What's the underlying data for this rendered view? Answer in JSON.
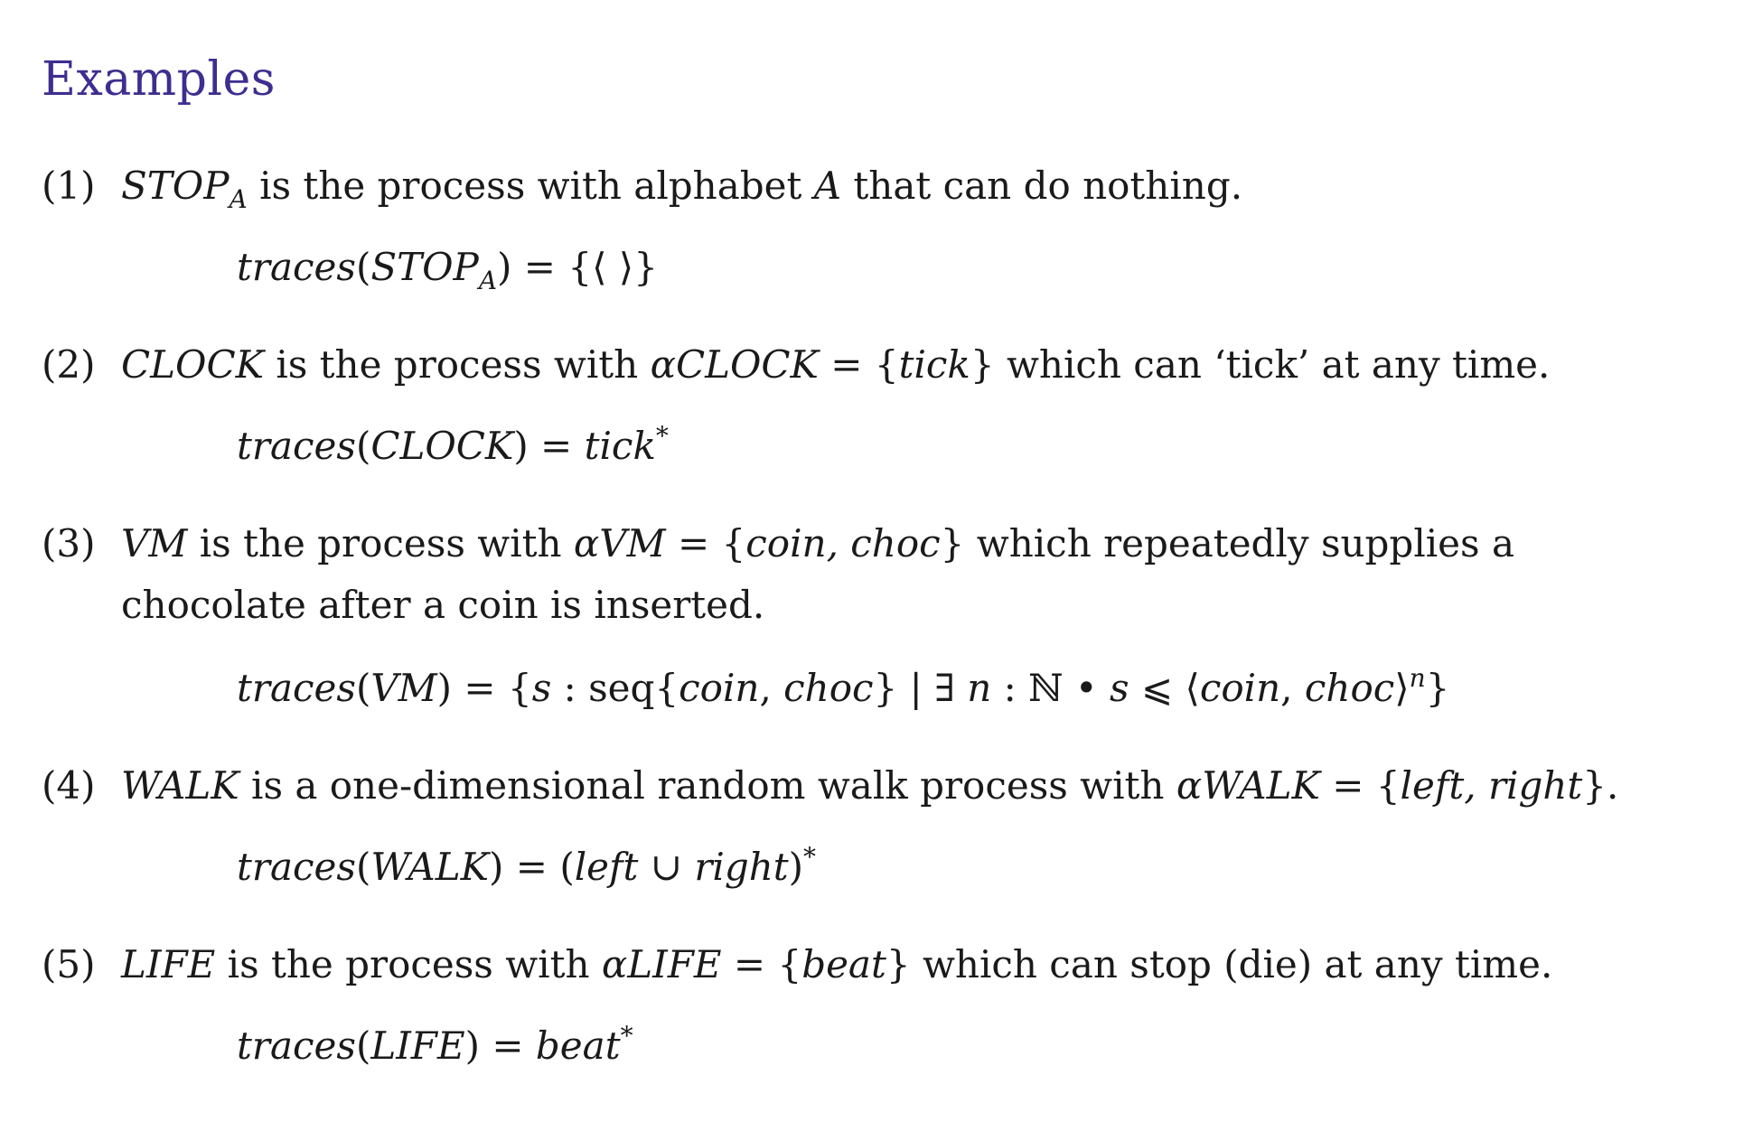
{
  "title": "Examples",
  "items": [
    {
      "number": "(1)",
      "name": "STOP",
      "name_sub": "A",
      "text_a": " is the process with alphabet ",
      "alpha": "A",
      "text_b": " that can do nothing.",
      "formula": {
        "fn": "traces",
        "lp": "(",
        "arg": "STOP",
        "arg_sub": "A",
        "rp": ")",
        "eq": " = ",
        "rhs": "{⟨ ⟩}"
      }
    },
    {
      "number": "(2)",
      "name": "CLOCK",
      "text_a": " is the process with ",
      "alpha_sym": "α",
      "alpha_name": "CLOCK",
      "eq": " = ",
      "set_open": "{",
      "set_content": "tick",
      "set_close": "}",
      "text_b": " which can ‘tick’ at any time.",
      "formula": {
        "fn": "traces",
        "lp": "(",
        "arg": "CLOCK",
        "rp": ")",
        "eq": " = ",
        "rhs": "tick",
        "rhs_sup": "*"
      }
    },
    {
      "number": "(3)",
      "name": "VM",
      "text_a": " is the process with ",
      "alpha_sym": "α",
      "alpha_name": "VM",
      "eq": " = ",
      "set_open": "{",
      "set_content": "coin, choc",
      "set_close": "}",
      "text_b": " which repeatedly supplies a",
      "line2": "chocolate after a coin is inserted.",
      "formula": {
        "fn": "traces",
        "lp": "(",
        "arg": "VM",
        "rp": ")",
        "eq": " = ",
        "p1": "{",
        "s": "s",
        "p2": " : seq{",
        "coin": "coin",
        "comma": ", ",
        "choc": "choc",
        "p3": "} | ∃ ",
        "n": "n",
        "p4": " : ℕ • ",
        "s2": "s",
        "p5": " ⩽ ⟨",
        "coin2": "coin",
        "comma2": ", ",
        "choc2": "choc",
        "p6": "⟩",
        "n_sup": "n",
        "p7": "}"
      }
    },
    {
      "number": "(4)",
      "name": "WALK",
      "text_a": " is a one-dimensional random walk process with ",
      "alpha_sym": "α",
      "alpha_name": "WALK",
      "eq": " = ",
      "set_open": "{",
      "set_content": "left, right",
      "set_close": "}.",
      "formula": {
        "fn": "traces",
        "lp": "(",
        "arg": "WALK",
        "rp": ")",
        "eq": " = ",
        "o": "(",
        "left": "left",
        "cup": " ∪ ",
        "right": "right",
        "c": ")",
        "rhs_sup": "*"
      }
    },
    {
      "number": "(5)",
      "name": "LIFE",
      "text_a": " is the process with ",
      "alpha_sym": "α",
      "alpha_name": "LIFE",
      "eq": " = ",
      "set_open": "{",
      "set_content": "beat",
      "set_close": "}",
      "text_b": " which can stop (die) at any time.",
      "formula": {
        "fn": "traces",
        "lp": "(",
        "arg": "LIFE",
        "rp": ")",
        "eq": " = ",
        "rhs": "beat",
        "rhs_sup": "*"
      }
    }
  ]
}
